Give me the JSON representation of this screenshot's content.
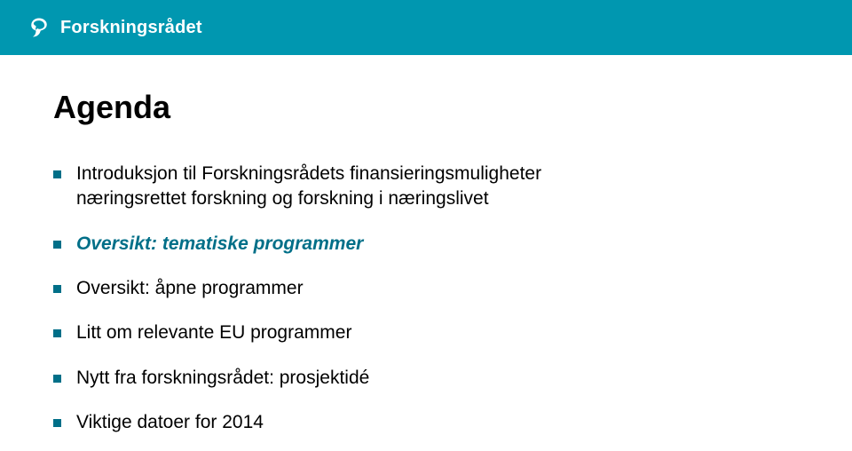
{
  "header": {
    "brand": "Forskningsrådet"
  },
  "title": "Agenda",
  "items": {
    "i0a": "Introduksjon til Forskningsrådets finansieringsmuligheter",
    "i0b": "næringsrettet forskning og forskning i næringslivet",
    "i1": "Oversikt: tematiske programmer",
    "i2": "Oversikt: åpne programmer",
    "i3": "Litt om relevante EU programmer",
    "i4": "Nytt fra forskningsrådet: prosjektidé",
    "i5": "Viktige datoer for 2014"
  },
  "colors": {
    "header_bg": "#0097b0",
    "accent": "#006f88"
  }
}
